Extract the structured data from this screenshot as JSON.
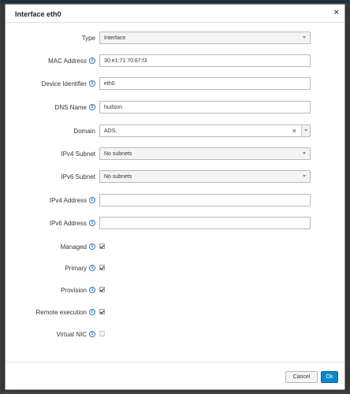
{
  "modal": {
    "title": "Interface eth0",
    "close_glyph": "×"
  },
  "fields": {
    "type": {
      "label": "Type",
      "value": "Interface"
    },
    "mac": {
      "label": "MAC Address",
      "value": "30:e1:71:70:87:f3"
    },
    "device_identifier": {
      "label": "Device Identifier",
      "value": "eth0"
    },
    "dns_name": {
      "label": "DNS Name",
      "value": "hudson"
    },
    "domain": {
      "label": "Domain",
      "value": "ADS.",
      "clear_glyph": "×"
    },
    "ipv4_subnet": {
      "label": "IPv4 Subnet",
      "value": "No subnets"
    },
    "ipv6_subnet": {
      "label": "IPv6 Subnet",
      "value": "No subnets"
    },
    "ipv4_address": {
      "label": "IPv4 Address",
      "value": ""
    },
    "ipv6_address": {
      "label": "IPv6 Address",
      "value": ""
    }
  },
  "checkboxes": {
    "managed": {
      "label": "Managed",
      "checked": true
    },
    "primary": {
      "label": "Primary",
      "checked": true
    },
    "provision": {
      "label": "Provision",
      "checked": true
    },
    "remote_execution": {
      "label": "Remote execution",
      "checked": true
    },
    "virtual_nic": {
      "label": "Virtual NIC",
      "checked": false
    }
  },
  "info_glyph": "i",
  "footer": {
    "cancel_label": "Cancel",
    "ok_label": "Ok"
  },
  "colors": {
    "primary_button": "#0088ce",
    "info_icon": "#2a7ac4"
  }
}
